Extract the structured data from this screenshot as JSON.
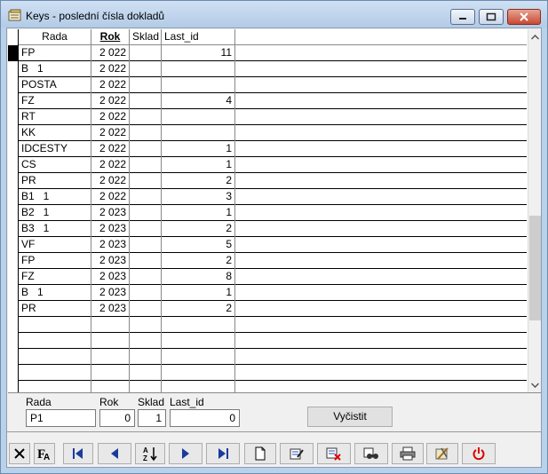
{
  "window": {
    "title": "Keys - poslední čísla dokladů"
  },
  "grid": {
    "columns": [
      "Rada",
      "Rok",
      "Sklad",
      "Last_id"
    ],
    "rows": [
      {
        "rada": "FP",
        "rok": "2 022",
        "sklad": "",
        "last": "11"
      },
      {
        "rada": "B   1",
        "rok": "2 022",
        "sklad": "",
        "last": ""
      },
      {
        "rada": "POSTA",
        "rok": "2 022",
        "sklad": "",
        "last": ""
      },
      {
        "rada": "FZ",
        "rok": "2 022",
        "sklad": "",
        "last": "4"
      },
      {
        "rada": "RT",
        "rok": "2 022",
        "sklad": "",
        "last": ""
      },
      {
        "rada": "KK",
        "rok": "2 022",
        "sklad": "",
        "last": ""
      },
      {
        "rada": "IDCESTY",
        "rok": "2 022",
        "sklad": "",
        "last": "1"
      },
      {
        "rada": "CS",
        "rok": "2 022",
        "sklad": "",
        "last": "1"
      },
      {
        "rada": "PR",
        "rok": "2 022",
        "sklad": "",
        "last": "2"
      },
      {
        "rada": "B1   1",
        "rok": "2 022",
        "sklad": "",
        "last": "3"
      },
      {
        "rada": "B2   1",
        "rok": "2 023",
        "sklad": "",
        "last": "1"
      },
      {
        "rada": "B3   1",
        "rok": "2 023",
        "sklad": "",
        "last": "2"
      },
      {
        "rada": "VF",
        "rok": "2 023",
        "sklad": "",
        "last": "5"
      },
      {
        "rada": "FP",
        "rok": "2 023",
        "sklad": "",
        "last": "2"
      },
      {
        "rada": "FZ",
        "rok": "2 023",
        "sklad": "",
        "last": "8"
      },
      {
        "rada": "B   1",
        "rok": "2 023",
        "sklad": "",
        "last": "1"
      },
      {
        "rada": "PR",
        "rok": "2 023",
        "sklad": "",
        "last": "2"
      },
      {
        "rada": "",
        "rok": "",
        "sklad": "",
        "last": ""
      },
      {
        "rada": "",
        "rok": "",
        "sklad": "",
        "last": ""
      },
      {
        "rada": "",
        "rok": "",
        "sklad": "",
        "last": ""
      },
      {
        "rada": "",
        "rok": "",
        "sklad": "",
        "last": ""
      },
      {
        "rada": "",
        "rok": "",
        "sklad": "",
        "last": ""
      }
    ]
  },
  "form": {
    "rada_label": "Rada",
    "rok_label": "Rok",
    "sklad_label": "Sklad",
    "last_label": "Last_id",
    "rada_value": "P1",
    "rok_value": "0",
    "sklad_value": "1",
    "last_value": "0",
    "clear_button": "Vyčistit"
  },
  "toolbar": {
    "buttons": [
      "close-x-icon",
      "font-icon",
      "first-record-icon",
      "previous-record-icon",
      "sort-az-icon",
      "next-record-icon",
      "last-record-icon",
      "new-document-icon",
      "edit-icon",
      "delete-icon",
      "find-icon",
      "print-icon",
      "tools-icon",
      "power-icon"
    ]
  }
}
